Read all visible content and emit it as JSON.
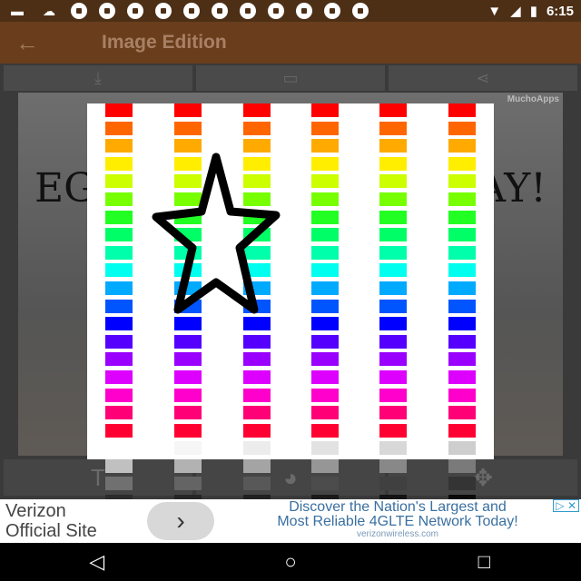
{
  "status_bar": {
    "time": "6:15"
  },
  "app_bar": {
    "title": "Image Edition"
  },
  "photo": {
    "watermark": "MuchoApps",
    "text_left": "EGG",
    "text_right": "AY!"
  },
  "colors": {
    "brand_dark": "#4d2f16",
    "brand": "#6a3e1c",
    "hue_swatches": [
      "#ff0000",
      "#ff6600",
      "#ffaa00",
      "#ffee00",
      "#ccff00",
      "#77ff00",
      "#22ff22",
      "#00ff66",
      "#00ffaa",
      "#00ffee",
      "#00aaff",
      "#0055ff",
      "#0000ff",
      "#5500ff",
      "#9900ff",
      "#dd00ff",
      "#ff00cc",
      "#ff0077",
      "#ff0033"
    ]
  },
  "ad": {
    "left_line1": "Verizon",
    "left_line2": "Official Site",
    "right_line1": "Discover the Nation's Largest and",
    "right_line2": "Most Reliable 4GLTE Network Today!",
    "url": "verizonwireless.com"
  }
}
